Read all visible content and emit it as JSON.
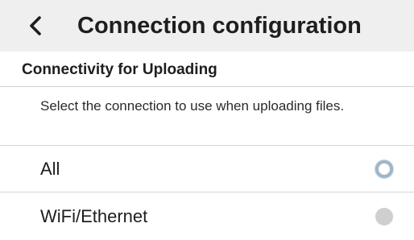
{
  "header": {
    "back_icon": "chevron-left-icon",
    "title": "Connection configuration"
  },
  "section": {
    "title": "Connectivity for Uploading",
    "description": "Select the connection to use when uploading files."
  },
  "options": [
    {
      "label": "All",
      "selected": true
    },
    {
      "label": "WiFi/Ethernet",
      "selected": false
    }
  ],
  "colors": {
    "header_bg": "#efefef",
    "radio_selected": "#9fb6c8",
    "radio_unselected": "#cfcfcf"
  }
}
